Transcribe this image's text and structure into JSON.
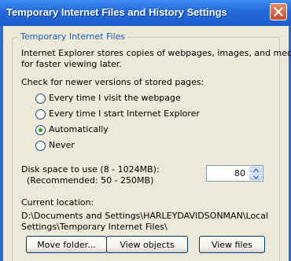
{
  "window": {
    "title": "Temporary Internet Files and History Settings",
    "close_icon": "close-icon"
  },
  "group": {
    "legend": "Temporary Internet Files",
    "description_line1": "Internet Explorer stores copies of webpages, images, and media",
    "description_line2": "for faster viewing later.",
    "check_label": "Check for newer versions of stored pages:",
    "options": [
      {
        "label": "Every time I visit the webpage",
        "checked": false
      },
      {
        "label": "Every time I start Internet Explorer",
        "checked": false
      },
      {
        "label": "Automatically",
        "checked": true
      },
      {
        "label": "Never",
        "checked": false
      }
    ],
    "disk_space_label_line1": "Disk space to use (8 - 1024MB):",
    "disk_space_label_line2": "(Recommended: 50 - 250MB)",
    "disk_space_value": "80",
    "current_location_label": "Current location:",
    "current_location_line1": "D:\\Documents and Settings\\HARLEYDAVIDSONMAN\\Local",
    "current_location_line2": "Settings\\Temporary Internet Files\\"
  },
  "buttons": {
    "move_folder": "Move folder...",
    "view_objects": "View objects",
    "view_files": "View files"
  },
  "colors": {
    "titlebar": "#2368d8",
    "client_bg": "#ece9d8",
    "group_label": "#1b5abf",
    "close_button": "#c9482a",
    "radio_dot": "#21a121"
  }
}
